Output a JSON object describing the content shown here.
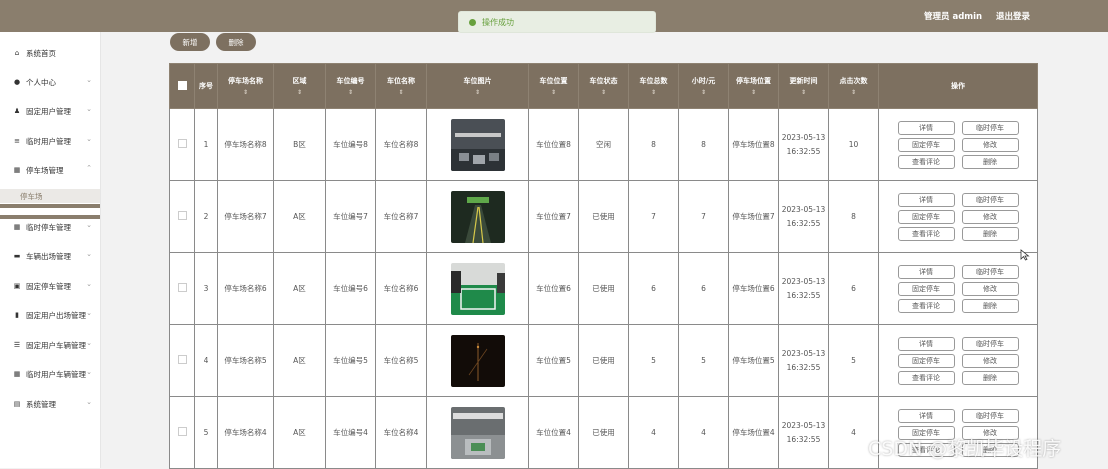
{
  "header": {
    "user": "管理员 admin",
    "logout": "退出登录"
  },
  "toast": "操作成功",
  "sidebar": [
    {
      "label": "系统首页",
      "icon": "home-icon",
      "chev": ""
    },
    {
      "label": "个人中心",
      "icon": "person-icon",
      "chev": "⌄"
    },
    {
      "label": "固定用户管理",
      "icon": "user-icon",
      "chev": "⌄"
    },
    {
      "label": "临时用户管理",
      "icon": "list-icon",
      "chev": "⌄"
    },
    {
      "label": "停车场管理",
      "icon": "grid-icon",
      "chev": "⌃"
    },
    {
      "label": "临时停车管理",
      "icon": "grid-icon",
      "chev": "⌄"
    },
    {
      "label": "车辆出场管理",
      "icon": "monitor-icon",
      "chev": "⌄"
    },
    {
      "label": "固定停车管理",
      "icon": "image-icon",
      "chev": "⌄"
    },
    {
      "label": "固定用户出场管理",
      "icon": "car-icon",
      "chev": "⌄"
    },
    {
      "label": "固定用户车辆管理",
      "icon": "sliders-icon",
      "chev": "⌄"
    },
    {
      "label": "临时用户车辆管理",
      "icon": "grid-icon",
      "chev": "⌄"
    },
    {
      "label": "系统管理",
      "icon": "clipboard-icon",
      "chev": "⌄"
    }
  ],
  "submenu": {
    "label": "停车场"
  },
  "actions": {
    "add": "新增",
    "delete": "删除"
  },
  "table": {
    "headers": [
      "序号",
      "停车场名称",
      "区域",
      "车位编号",
      "车位名称",
      "车位图片",
      "车位位置",
      "车位状态",
      "车位总数",
      "小时/元",
      "停车场位置",
      "更新时间",
      "点击次数",
      "操作"
    ],
    "ops": [
      "详情",
      "临时停车",
      "固定停车",
      "修改",
      "查看评论",
      "删除"
    ],
    "rows": [
      {
        "no": "1",
        "name": "停车场名称8",
        "area": "B区",
        "code": "车位编号8",
        "slot": "车位名称8",
        "pos": "车位位置8",
        "status": "空闲",
        "total": "8",
        "price": "8",
        "lot_pos": "停车场位置8",
        "time": "2023-05-13 16:32:55",
        "clicks": "10"
      },
      {
        "no": "2",
        "name": "停车场名称7",
        "area": "A区",
        "code": "车位编号7",
        "slot": "车位名称7",
        "pos": "车位位置7",
        "status": "已使用",
        "total": "7",
        "price": "7",
        "lot_pos": "停车场位置7",
        "time": "2023-05-13 16:32:55",
        "clicks": "8"
      },
      {
        "no": "3",
        "name": "停车场名称6",
        "area": "A区",
        "code": "车位编号6",
        "slot": "车位名称6",
        "pos": "车位位置6",
        "status": "已使用",
        "total": "6",
        "price": "6",
        "lot_pos": "停车场位置6",
        "time": "2023-05-13 16:32:55",
        "clicks": "6"
      },
      {
        "no": "4",
        "name": "停车场名称5",
        "area": "A区",
        "code": "车位编号5",
        "slot": "车位名称5",
        "pos": "车位位置5",
        "status": "已使用",
        "total": "5",
        "price": "5",
        "lot_pos": "停车场位置5",
        "time": "2023-05-13 16:32:55",
        "clicks": "5"
      },
      {
        "no": "5",
        "name": "停车场名称4",
        "area": "A区",
        "code": "车位编号4",
        "slot": "车位名称4",
        "pos": "车位位置4",
        "status": "已使用",
        "total": "4",
        "price": "4",
        "lot_pos": "停车场位置4",
        "time": "2023-05-13 16:32:55",
        "clicks": "4"
      }
    ]
  },
  "watermark": "CSDN @黎凯毕设程序"
}
